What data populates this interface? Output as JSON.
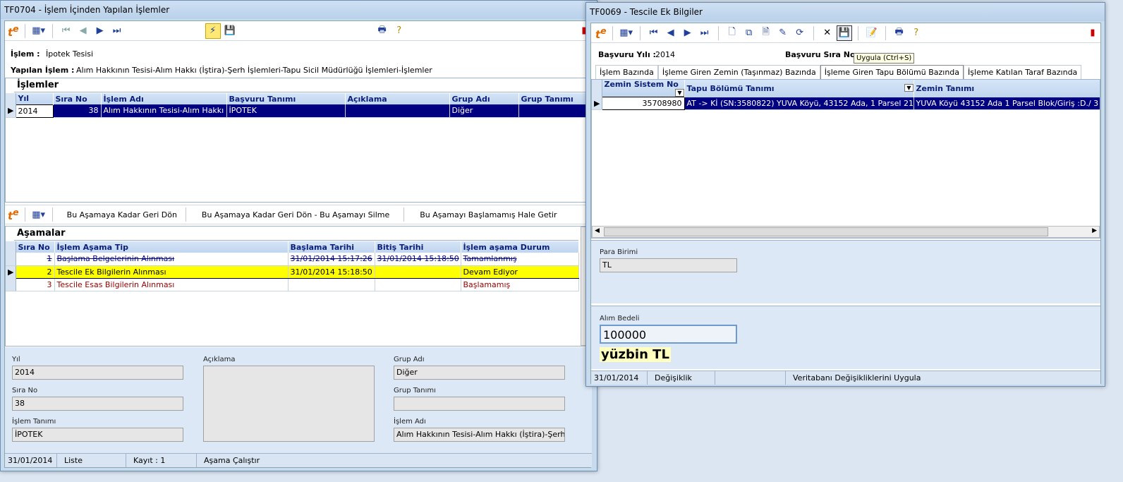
{
  "left": {
    "title": "TF0704 - İşlem İçinden Yapılan İşlemler",
    "islem_label": "İşlem :",
    "islem_value": "İpotek Tesisi",
    "yapilan_label": "Yapılan İşlem :",
    "yapilan_value": "Alım Hakkının Tesisi-Alım Hakkı (İştira)-Şerh İşlemleri-Tapu Sicil Müdürlüğü İşlemleri-İşlemler",
    "islemler_title": "İşlemler",
    "islemler_cols": [
      "Yıl",
      "Sıra No",
      "İşlem Adı",
      "Başvuru Tanımı",
      "Açıklama",
      "Grup Adı",
      "Grup Tanımı"
    ],
    "islemler_row": [
      "2014",
      "38",
      "Alım Hakkının Tesisi-Alım Hakkı (İştira",
      "İPOTEK",
      "",
      "Diğer",
      ""
    ],
    "stage_buttons": [
      "Bu Aşamaya Kadar Geri Dön",
      "Bu Aşamaya Kadar Geri Dön - Bu Aşamayı Silme",
      "Bu Aşamayı Başlamamış Hale Getir"
    ],
    "asamalar_title": "Aşamalar",
    "asamalar_cols": [
      "Sıra No",
      "İşlem Aşama Tip",
      "Başlama Tarihi",
      "Bitiş Tarihi",
      "İşlem aşama Durum"
    ],
    "asamalar_rows": [
      [
        "1",
        "Başlama Belgelerinin Alınması",
        "31/01/2014 15:17:26",
        "31/01/2014 15:18:50",
        "Tamamlanmış"
      ],
      [
        "2",
        "Tescile Ek Bilgilerin Alınması",
        "31/01/2014 15:18:50",
        "",
        "Devam Ediyor"
      ],
      [
        "3",
        "Tescile Esas Bilgilerin Alınması",
        "",
        "",
        "Başlamamış"
      ]
    ],
    "detail": {
      "yil_label": "Yıl",
      "yil": "2014",
      "sira_label": "Sıra No",
      "sira": "38",
      "tanim_label": "İşlem Tanımı",
      "tanim": "İPOTEK",
      "aciklama_label": "Açıklama",
      "grup_adi_label": "Grup Adı",
      "grup_adi": "Diğer",
      "grup_tanimi_label": "Grup Tanımı",
      "grup_tanimi": "",
      "islem_adi_label": "İşlem Adı",
      "islem_adi": "Alım Hakkının Tesisi-Alım Hakkı (İştira)-Şerh İşlemler"
    },
    "status": [
      "31/01/2014",
      "Liste",
      "Kayıt : 1",
      "Aşama Çalıştır"
    ]
  },
  "right": {
    "title": "TF0069 - Tescile Ek Bilgiler",
    "basvuru_yili_label": "Başvuru Yılı :",
    "basvuru_yili": "2014",
    "basvuru_sira_label": "Başvuru Sıra No :",
    "tooltip": "Uygula (Ctrl+S)",
    "tabs": [
      "İşlem Bazında",
      "İşleme Giren Zemin (Taşınmaz) Bazında",
      "İşleme Giren Tapu Bölümü Bazında",
      "İşleme Katılan Taraf Bazında"
    ],
    "cols": [
      "Zemin Sistem No",
      "Tapu Bölümü Tanımı",
      "Zemin Tanımı"
    ],
    "row": [
      "35708980",
      "AT -> Kİ (SN:3580822) YUVA Köyü,  43152 Ada, 1 Parsel  21.920 ap",
      "YUVA Köyü 43152 Ada 1 Parsel Blok/Giriş :D./ 3 nolu Ba"
    ],
    "para_birimi_label": "Para Birimi",
    "para_birimi": "TL",
    "alim_bedeli_label": "Alım Bedeli",
    "alim_bedeli": "100000",
    "alim_bedeli_yazi": "yüzbin TL",
    "status": [
      "31/01/2014",
      "Değişiklik",
      "",
      "Veritabanı Değişikliklerini Uygula"
    ]
  }
}
